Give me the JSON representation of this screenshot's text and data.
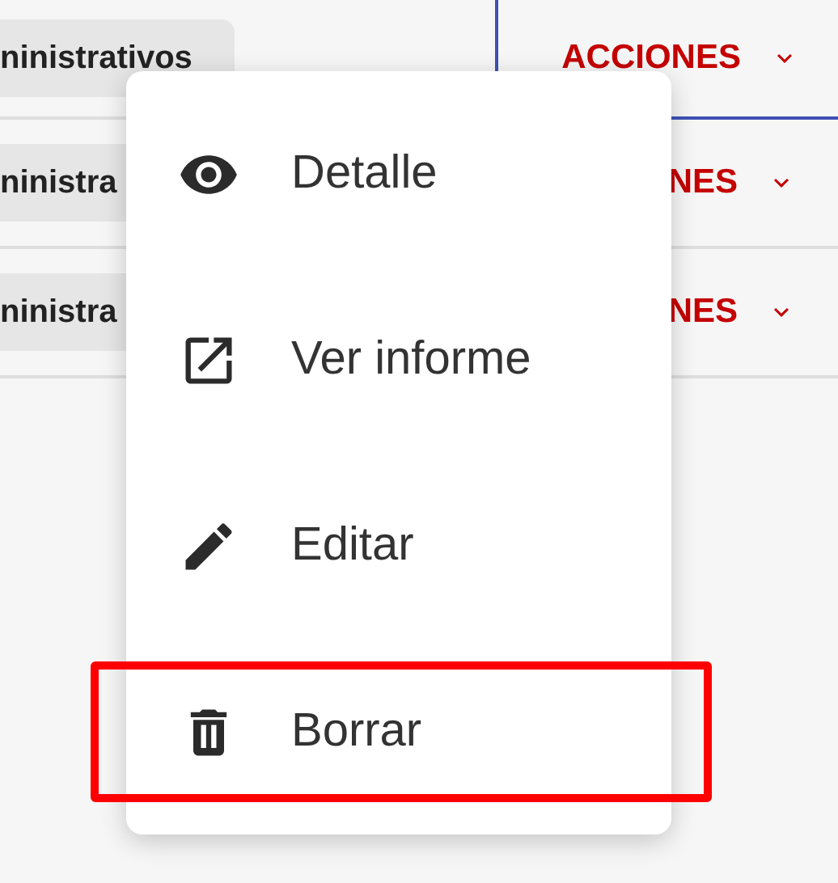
{
  "table": {
    "rows": [
      {
        "name": "ninistrativos",
        "action": "ACCIONES",
        "focused": true
      },
      {
        "name": "ninistra",
        "action": "NES",
        "focused": false
      },
      {
        "name": "ninistra",
        "action": "NES",
        "focused": false
      }
    ]
  },
  "menu": {
    "items": [
      {
        "label": "Detalle",
        "kind": "eye",
        "highlighted": false
      },
      {
        "label": "Ver informe",
        "kind": "open",
        "highlighted": false
      },
      {
        "label": "Editar",
        "kind": "edit",
        "highlighted": false
      },
      {
        "label": "Borrar",
        "kind": "delete",
        "highlighted": true
      }
    ]
  }
}
